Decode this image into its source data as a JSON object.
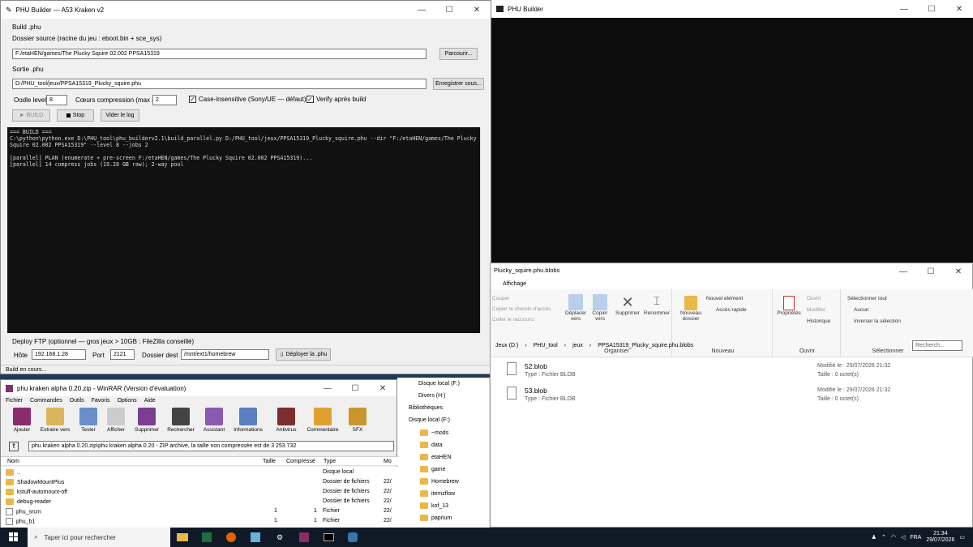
{
  "builder": {
    "title": "PHU Builder — A53 Kraken v2",
    "section_build": "Build .phu",
    "source_label": "Dossier source (racine du jeu : eboot.bin + sce_sys)",
    "source_value": "F:/etaHEN/games/The Plucky Squire 02.002 PPSA15319",
    "browse_label": "Parcourir...",
    "output_label": "Sortie .phu",
    "output_value": "D:/PHU_tool/jeux/PPSA15319_Plucky_squire.phu",
    "save_as_label": "Enregistrer sous...",
    "oodle_label": "Oodle level",
    "oodle_value": "8",
    "cores_label": "Cœurs compression (max 4)",
    "cores_value": "2",
    "case_label": "Case-insensitive (Sony/UE — défaut)",
    "verify_label": "Verify après build",
    "build_btn": "► BUILD",
    "stop_btn": "Stop",
    "clear_btn": "Vider le log",
    "log": "=== BUILD ===\nC:\\python\\python.exe D:\\PHU_tool\\phu_builderv2.1\\build_parallel.py D:/PHU_tool/jeux/PPSA15319_Plucky_squire.phu --dir \"F:/etaHEN/games/The Plucky Squire 02.002 PPSA15319\" --level 8 --jobs 2\n\n[parallel] PLAN (enumerate + pre-screen F:/etaHEN/games/The Plucky Squire 02.002 PPSA15319)...\n[parallel] 14 compress jobs (19.28 GB raw); 2-way pool",
    "ftp_label": "Deploy FTP (optionnel — gros jeux > 10GB : FileZilla conseillé)",
    "host_label": "Hôte",
    "host_value": "192.168.1.28",
    "port_label": "Port",
    "port_value": "2121",
    "dest_label": "Dossier dest",
    "dest_value": "/mnt/ext1/homebrew",
    "deploy_btn": "Déployer la .phu",
    "status": "Build en cours..."
  },
  "terminal": {
    "title": "PHU Builder"
  },
  "explorer": {
    "title": "Plucky_squire.phu.blobs",
    "tab": "Affichage",
    "ribbon": {
      "couper": "Couper",
      "copier_chemin": "Copier le chemin d'accès",
      "coller_raccourci": "Coller le raccourci",
      "deplacer": "Déplacer vers",
      "copier": "Copier vers",
      "supprimer": "Supprimer",
      "renommer": "Renommer",
      "organiser": "Organiser",
      "nouveau_dossier": "Nouveau dossier",
      "nouvel_element": "Nouvel élément",
      "acces_rapide": "Accès rapide",
      "nouveau": "Nouveau",
      "proprietes": "Propriétés",
      "ouvrir": "Ouvrir",
      "modifier": "Modifier",
      "historique": "Historique",
      "ouvrir_grp": "Ouvrir",
      "sel_tout": "Sélectionner tout",
      "aucun": "Aucun",
      "inverser": "Inverser la sélection",
      "selectionner": "Sélectionner"
    },
    "breadcrumb": [
      "Jeux (D:)",
      "PHU_tool",
      "jeux",
      "PPSA15319_Plucky_squire.phu.blobs"
    ],
    "search_placeholder": "Recherch...",
    "files": [
      {
        "name": "52.blob",
        "type": "Type : Fichier BLOB",
        "modified": "Modifié le : 29/07/2026 21:32",
        "size": "Taille : 0 octet(s)"
      },
      {
        "name": "53.blob",
        "type": "Type : Fichier BLOB",
        "modified": "Modifié le : 29/07/2026 21:32",
        "size": "Taille : 0 octet(s)"
      }
    ],
    "nav": [
      "Disque local (F:)",
      "Divers (H:)",
      "Bibliothèques",
      "Disque local (F:)",
      "~mods",
      "data",
      "etaHEN",
      "game",
      "Homebrew",
      "itemzflow",
      "kof_13",
      "paprium"
    ]
  },
  "winrar": {
    "title": "phu kraken alpha 0.20.zip - WinRAR (Version d'évaluation)",
    "menu": [
      "Fichier",
      "Commandes",
      "Outils",
      "Favoris",
      "Options",
      "Aide"
    ],
    "tools": [
      "Ajouter",
      "Extraire vers",
      "Tester",
      "Afficher",
      "Supprimer",
      "Rechercher",
      "Assistant",
      "Informations",
      "Antivirus",
      "Commentaire",
      "SFX"
    ],
    "path": "phu kraken alpha 0.20.zip\\phu kraken alpha 0.20 - ZIP archive, la taille non compressée est de 3 253 732",
    "cols": [
      "Nom",
      "Taille",
      "Compressé",
      "Type",
      "Mo"
    ],
    "rows": [
      {
        "name": "..",
        "size": "",
        "comp": "",
        "type": "Disque local",
        "mod": ""
      },
      {
        "name": "ShadowMountPlus",
        "size": "",
        "comp": "",
        "type": "Dossier de fichiers",
        "mod": "22/"
      },
      {
        "name": "kstuff-automount-off",
        "size": "",
        "comp": "",
        "type": "Dossier de fichiers",
        "mod": "22/"
      },
      {
        "name": "debug-reader",
        "size": "",
        "comp": "",
        "type": "Dossier de fichiers",
        "mod": "22/"
      },
      {
        "name": "phu_srcm",
        "size": "1",
        "comp": "1",
        "type": "Fichier",
        "mod": "22/"
      },
      {
        "name": "phu_b1",
        "size": "1",
        "comp": "1",
        "type": "Fichier",
        "mod": "22/"
      }
    ]
  },
  "taskbar": {
    "search": "Taper ici pour rechercher",
    "lang": "FRA",
    "time": "21:34",
    "date": "29/07/2026"
  },
  "colors": {
    "log_bg": "#111111",
    "taskbar": "#101a26",
    "folder": "#e8b84a"
  }
}
